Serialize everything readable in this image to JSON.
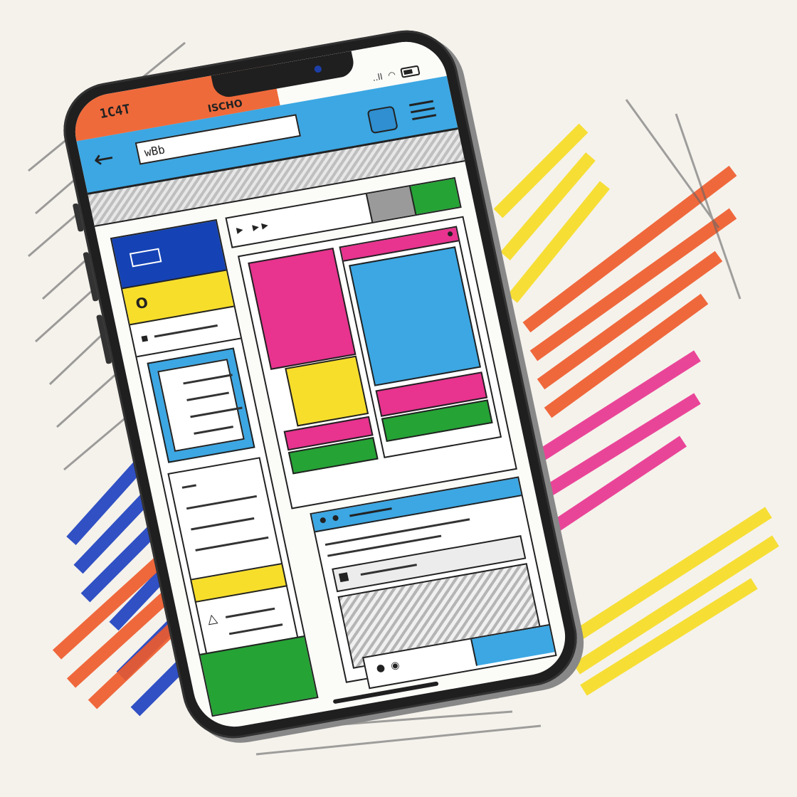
{
  "status_bar": {
    "carrier": "1C4T",
    "label": "ISCHO",
    "signal": "..ll"
  },
  "toolbar": {
    "back_glyph": "←",
    "url_value": "wBb"
  },
  "nav_strip": {
    "arrows": "▸ ▸▸"
  },
  "bottom_bar": {
    "dots": "● ◉"
  },
  "colors": {
    "orange": "#ef6a3a",
    "blue": "#3ca7e3",
    "dark_blue": "#1543b5",
    "yellow": "#f7de2a",
    "pink": "#e8338f",
    "green": "#25a335"
  },
  "icons": [
    "back-arrow-icon",
    "tabs-icon",
    "menu-icon",
    "signal-icon",
    "wifi-icon",
    "battery-icon"
  ]
}
